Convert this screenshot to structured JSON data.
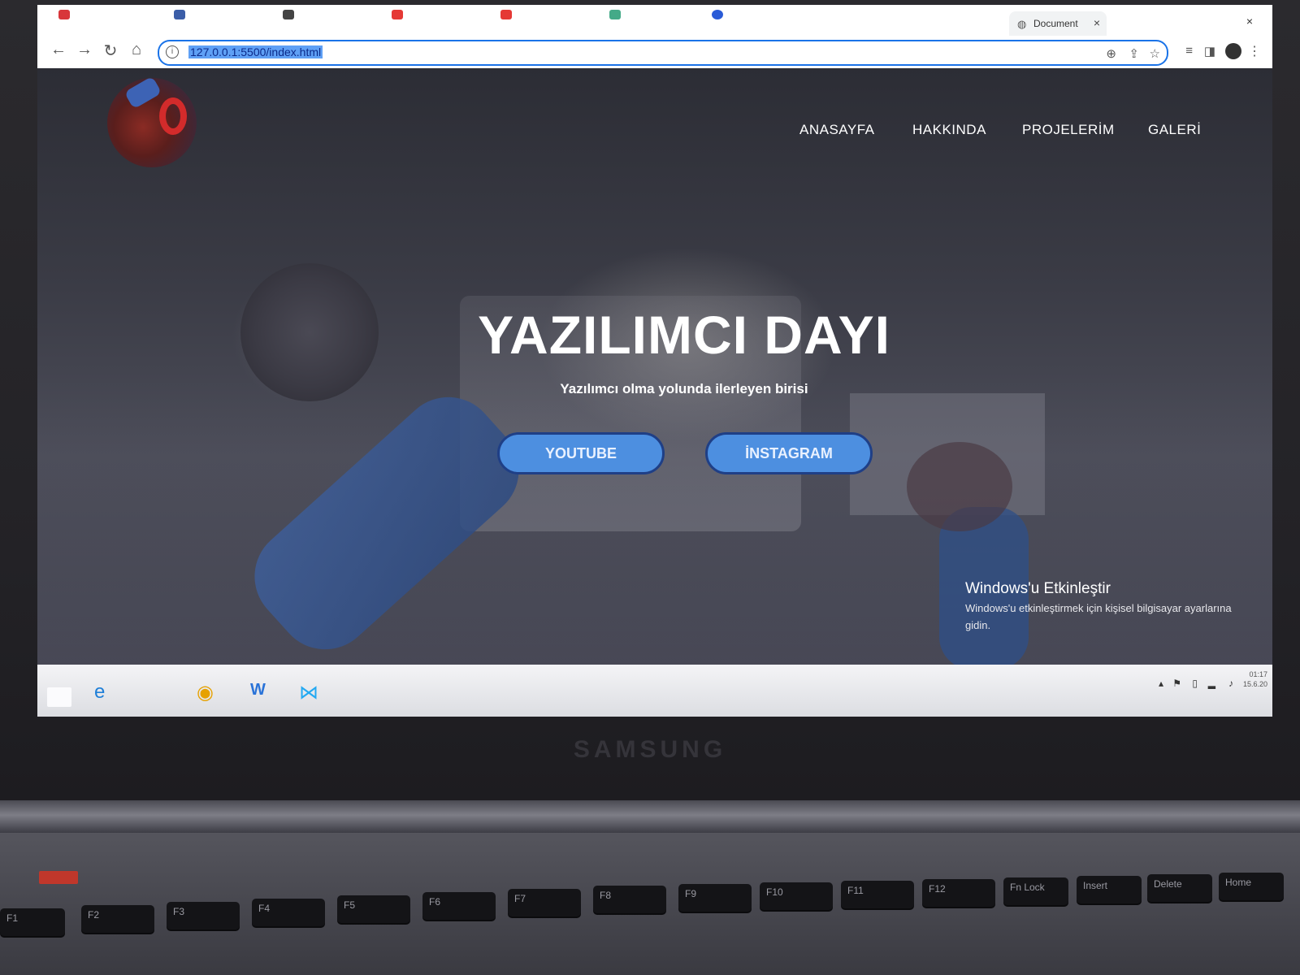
{
  "browser": {
    "tab_title": "Document",
    "tab_close": "×",
    "window_close": "×",
    "url": "127.0.0.1:5500/index.html"
  },
  "site": {
    "nav": [
      "ANASAYFA",
      "HAKKINDA",
      "PROJELERİM",
      "GALERİ"
    ],
    "hero_title": "YAZILIMCI DAYI",
    "hero_subtitle": "Yazılımcı olma yolunda ilerleyen birisi",
    "buttons": {
      "youtube": "YOUTUBE",
      "instagram": "İNSTAGRAM"
    }
  },
  "watermark": {
    "title": "Windows'u Etkinleştir",
    "text": "Windows'u etkinleştirmek için kişisel bilgisayar ayarlarına gidin."
  },
  "taskbar": {
    "apps": [
      "internet-explorer-icon",
      "chrome-icon",
      "word-icon",
      "vscode-icon"
    ],
    "clock_time": "01:17",
    "clock_date": "15.6.20"
  },
  "hardware": {
    "brand": "SAMSUNG",
    "keys": [
      "F1",
      "F2",
      "F3",
      "F4",
      "F5",
      "F6",
      "F7",
      "F8",
      "F9",
      "F10",
      "F11",
      "F12",
      "Fn Lock",
      "Insert",
      "Delete",
      "Home"
    ]
  },
  "colors": {
    "button_fill": "#4d8fe0",
    "button_border": "#1f3f86",
    "url_highlight": "#5fa0f5",
    "accent_red": "#d32b2b"
  }
}
